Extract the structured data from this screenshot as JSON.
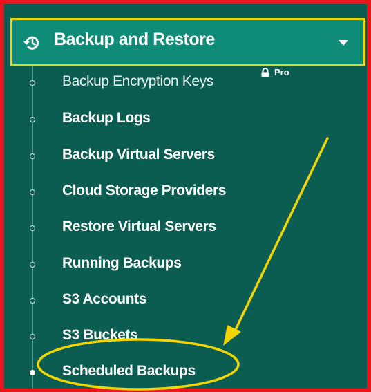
{
  "header": {
    "title": "Backup and Restore",
    "icon": "history-icon",
    "caret": "chevron-down-icon"
  },
  "menu": {
    "items": [
      {
        "label": "Backup Encryption Keys",
        "badge": "Pro",
        "locked": true
      },
      {
        "label": "Backup Logs"
      },
      {
        "label": "Backup Virtual Servers"
      },
      {
        "label": "Cloud Storage Providers"
      },
      {
        "label": "Restore Virtual Servers"
      },
      {
        "label": "Running Backups"
      },
      {
        "label": "S3 Accounts"
      },
      {
        "label": "S3 Buckets"
      },
      {
        "label": "Scheduled Backups",
        "active": true
      }
    ]
  },
  "colors": {
    "panel": "#0b5d51",
    "header": "#0e8c78",
    "outer_border": "#e8151b",
    "highlight": "#f2d500"
  }
}
